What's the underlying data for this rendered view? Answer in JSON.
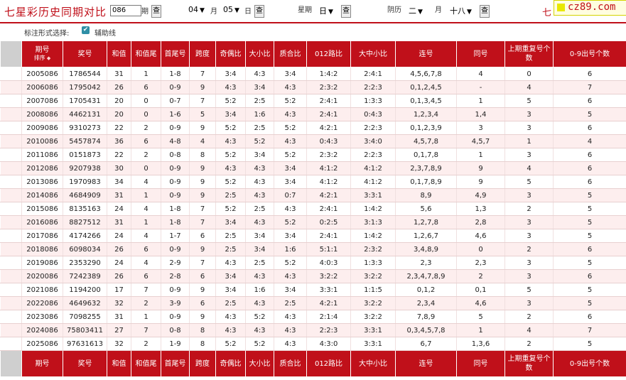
{
  "topbar": {
    "title": "七星彩历史同期对比",
    "period_value": "086",
    "period_label": "期",
    "query_label": "查",
    "month_value": "04",
    "month_label": "月",
    "day_value": "05",
    "day_label": "日",
    "weekday_prefix": "星期",
    "weekday_value": "日",
    "lunar_prefix": "阴历",
    "lunar_month_value": "二",
    "lunar_month_label": "月",
    "lunar_day_value": "十八",
    "right_link_text": "七",
    "logo_text": "cz89.com"
  },
  "options": {
    "label": "标注形式选择:",
    "checkbox_label": "辅助线",
    "checkbox_checked": true
  },
  "table": {
    "headers": [
      "",
      "期号",
      "奖号",
      "和值",
      "和值尾",
      "首尾号",
      "跨度",
      "奇偶比",
      "大小比",
      "质合比",
      "012路比",
      "大中小比",
      "连号",
      "同号",
      "上期重复号个数",
      "0-9出号个数"
    ],
    "sort_label": "排序",
    "rows": [
      [
        "2005086",
        "1786544",
        "31",
        "1",
        "1-8",
        "7",
        "3:4",
        "4:3",
        "3:4",
        "1:4:2",
        "2:4:1",
        "4,5,6,7,8",
        "4",
        "0",
        "6"
      ],
      [
        "2006086",
        "1795042",
        "26",
        "6",
        "0-9",
        "9",
        "4:3",
        "3:4",
        "4:3",
        "2:3:2",
        "2:2:3",
        "0,1,2,4,5",
        "-",
        "4",
        "7"
      ],
      [
        "2007086",
        "1705431",
        "20",
        "0",
        "0-7",
        "7",
        "5:2",
        "2:5",
        "5:2",
        "2:4:1",
        "1:3:3",
        "0,1,3,4,5",
        "1",
        "5",
        "6"
      ],
      [
        "2008086",
        "4462131",
        "20",
        "0",
        "1-6",
        "5",
        "3:4",
        "1:6",
        "4:3",
        "2:4:1",
        "0:4:3",
        "1,2,3,4",
        "1,4",
        "3",
        "5"
      ],
      [
        "2009086",
        "9310273",
        "22",
        "2",
        "0-9",
        "9",
        "5:2",
        "2:5",
        "5:2",
        "4:2:1",
        "2:2:3",
        "0,1,2,3,9",
        "3",
        "3",
        "6"
      ],
      [
        "2010086",
        "5457874",
        "36",
        "6",
        "4-8",
        "4",
        "4:3",
        "5:2",
        "4:3",
        "0:4:3",
        "3:4:0",
        "4,5,7,8",
        "4,5,7",
        "1",
        "4"
      ],
      [
        "2011086",
        "0151873",
        "22",
        "2",
        "0-8",
        "8",
        "5:2",
        "3:4",
        "5:2",
        "2:3:2",
        "2:2:3",
        "0,1,7,8",
        "1",
        "3",
        "6"
      ],
      [
        "2012086",
        "9207938",
        "30",
        "0",
        "0-9",
        "9",
        "4:3",
        "4:3",
        "3:4",
        "4:1:2",
        "4:1:2",
        "2,3,7,8,9",
        "9",
        "4",
        "6"
      ],
      [
        "2013086",
        "1970983",
        "34",
        "4",
        "0-9",
        "9",
        "5:2",
        "4:3",
        "3:4",
        "4:1:2",
        "4:1:2",
        "0,1,7,8,9",
        "9",
        "5",
        "6"
      ],
      [
        "2014086",
        "4684909",
        "31",
        "1",
        "0-9",
        "9",
        "2:5",
        "4:3",
        "0:7",
        "4:2:1",
        "3:3:1",
        "8,9",
        "4,9",
        "3",
        "5"
      ],
      [
        "2015086",
        "8135163",
        "24",
        "4",
        "1-8",
        "7",
        "5:2",
        "2:5",
        "4:3",
        "2:4:1",
        "1:4:2",
        "5,6",
        "1,3",
        "2",
        "5"
      ],
      [
        "2016086",
        "8827512",
        "31",
        "1",
        "1-8",
        "7",
        "3:4",
        "4:3",
        "5:2",
        "0:2:5",
        "3:1:3",
        "1,2,7,8",
        "2,8",
        "3",
        "5"
      ],
      [
        "2017086",
        "4174266",
        "24",
        "4",
        "1-7",
        "6",
        "2:5",
        "3:4",
        "3:4",
        "2:4:1",
        "1:4:2",
        "1,2,6,7",
        "4,6",
        "3",
        "5"
      ],
      [
        "2018086",
        "6098034",
        "26",
        "6",
        "0-9",
        "9",
        "2:5",
        "3:4",
        "1:6",
        "5:1:1",
        "2:3:2",
        "3,4,8,9",
        "0",
        "2",
        "6"
      ],
      [
        "2019086",
        "2353290",
        "24",
        "4",
        "2-9",
        "7",
        "4:3",
        "2:5",
        "5:2",
        "4:0:3",
        "1:3:3",
        "2,3",
        "2,3",
        "3",
        "5"
      ],
      [
        "2020086",
        "7242389",
        "26",
        "6",
        "2-8",
        "6",
        "3:4",
        "4:3",
        "4:3",
        "3:2:2",
        "3:2:2",
        "2,3,4,7,8,9",
        "2",
        "3",
        "6"
      ],
      [
        "2021086",
        "1194200",
        "17",
        "7",
        "0-9",
        "9",
        "3:4",
        "1:6",
        "3:4",
        "3:3:1",
        "1:1:5",
        "0,1,2",
        "0,1",
        "5",
        "5"
      ],
      [
        "2022086",
        "4649632",
        "32",
        "2",
        "3-9",
        "6",
        "2:5",
        "4:3",
        "2:5",
        "4:2:1",
        "3:2:2",
        "2,3,4",
        "4,6",
        "3",
        "5"
      ],
      [
        "2023086",
        "7098255",
        "31",
        "1",
        "0-9",
        "9",
        "4:3",
        "5:2",
        "4:3",
        "2:1:4",
        "3:2:2",
        "7,8,9",
        "5",
        "2",
        "6"
      ],
      [
        "2024086",
        "75803411",
        "27",
        "7",
        "0-8",
        "8",
        "4:3",
        "4:3",
        "4:3",
        "2:2:3",
        "3:3:1",
        "0,3,4,5,7,8",
        "1",
        "4",
        "7"
      ],
      [
        "2025086",
        "97631613",
        "32",
        "2",
        "1-9",
        "8",
        "5:2",
        "5:2",
        "4:3",
        "4:3:0",
        "3:3:1",
        "6,7",
        "1,3,6",
        "2",
        "5"
      ]
    ]
  },
  "colors": {
    "accent_red": "#c0101a",
    "row_alt": "#fdeeee",
    "checkbox_teal": "#2f8fa6"
  }
}
